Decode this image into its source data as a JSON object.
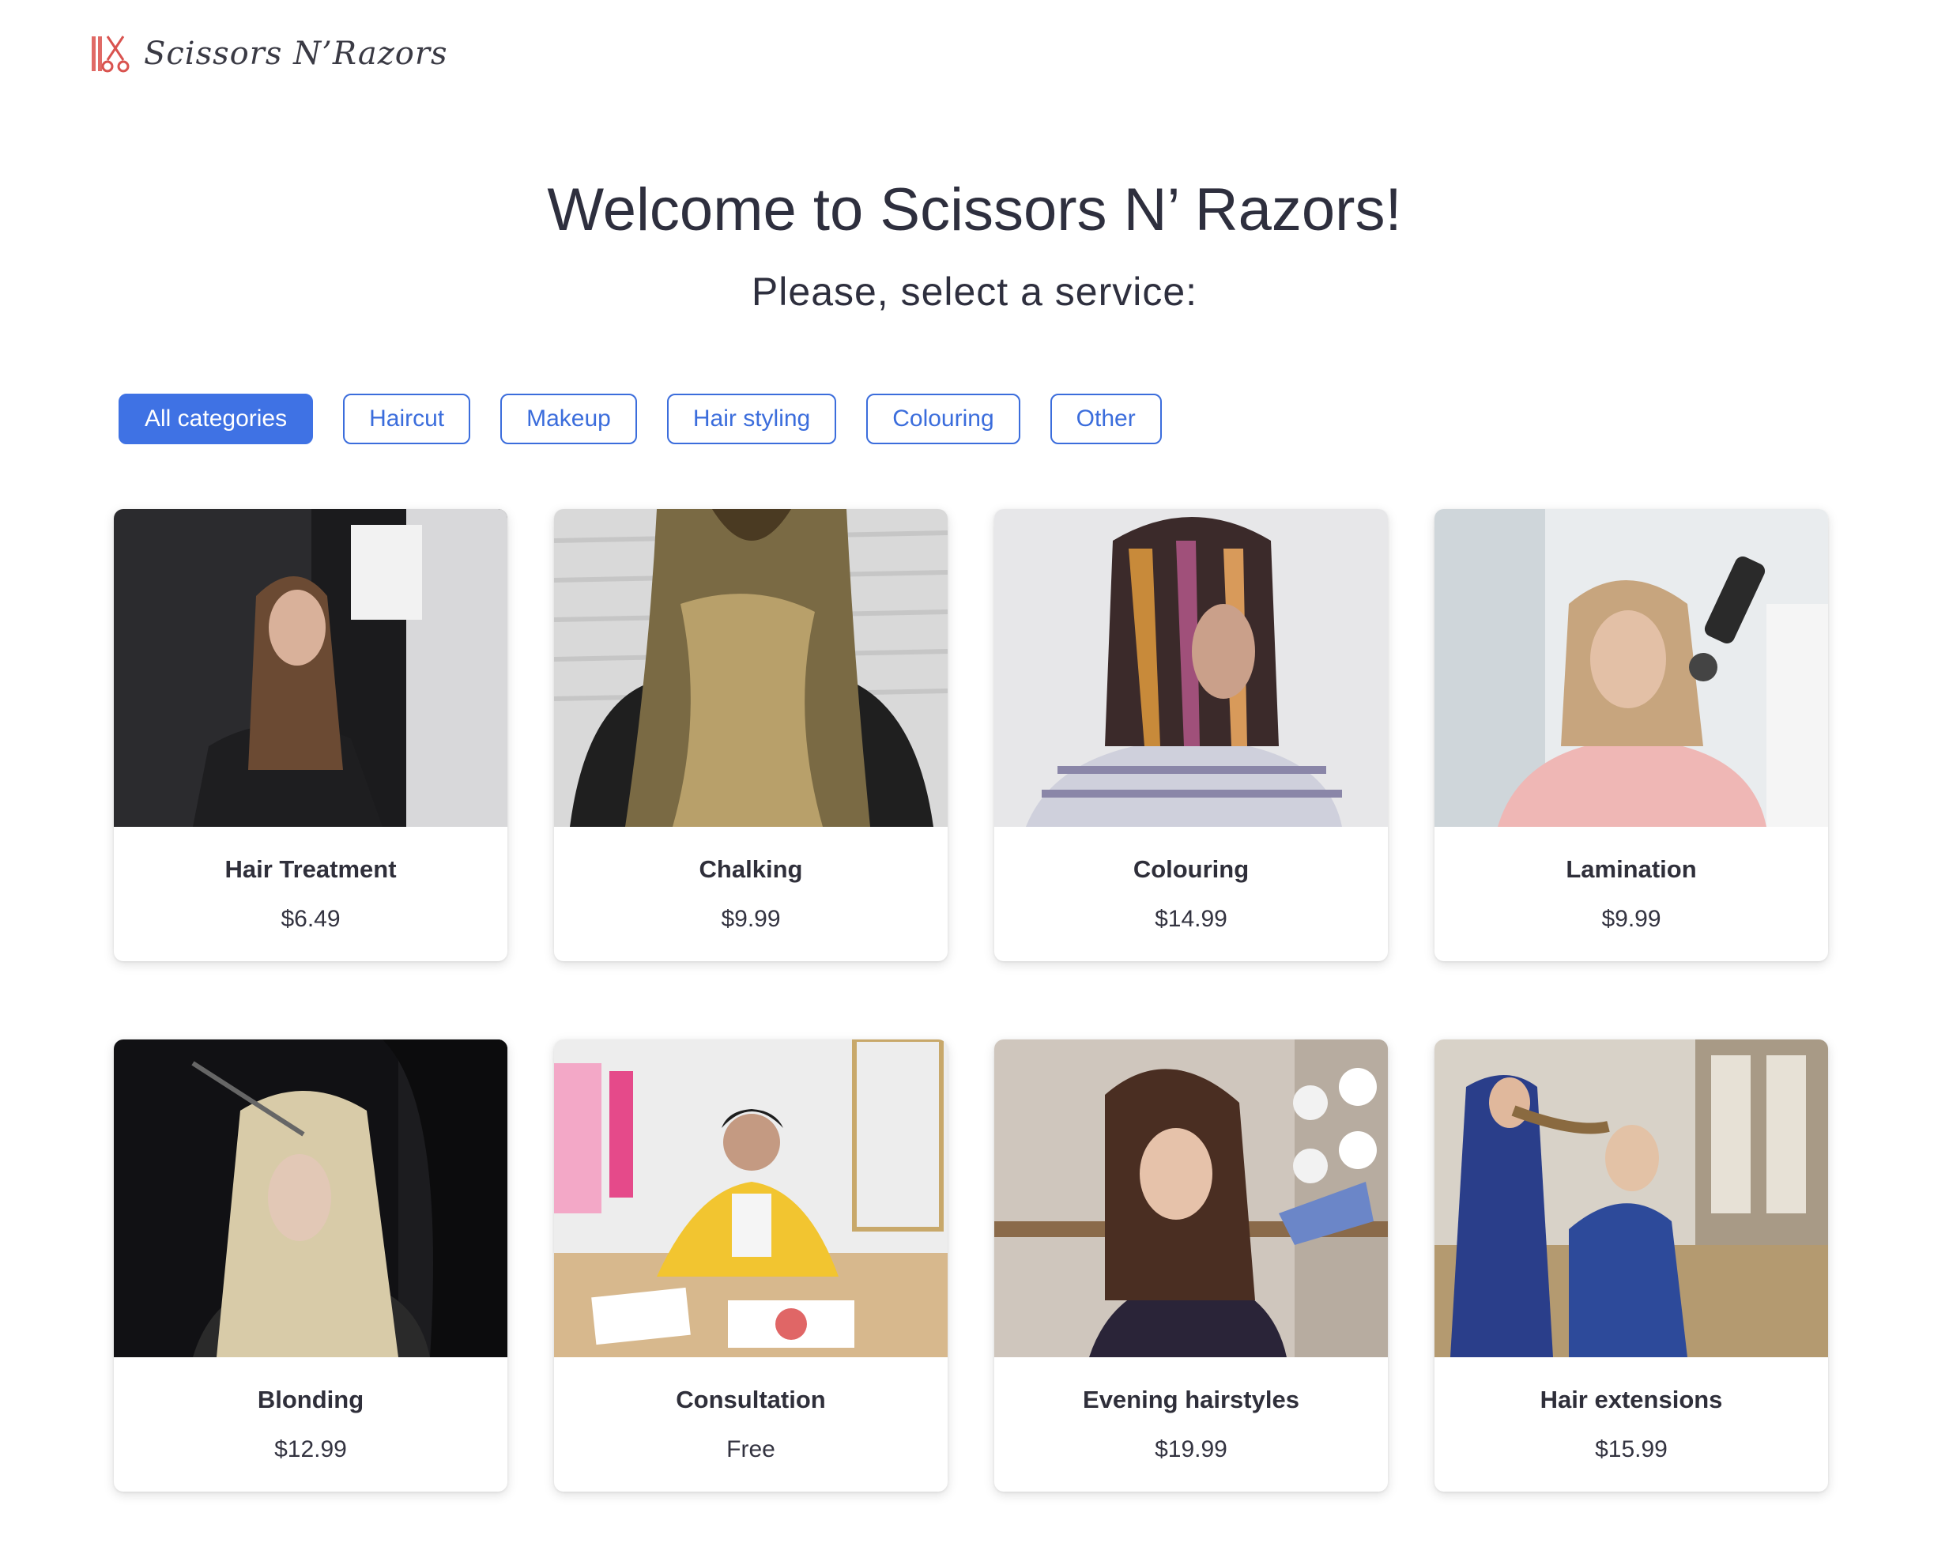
{
  "header": {
    "logo_text": "Scissors N’Razors"
  },
  "hero": {
    "title": "Welcome to Scissors N’ Razors!",
    "subtitle": "Please, select a service:"
  },
  "filters": [
    {
      "label": "All categories",
      "active": true
    },
    {
      "label": "Haircut",
      "active": false
    },
    {
      "label": "Makeup",
      "active": false
    },
    {
      "label": "Hair styling",
      "active": false
    },
    {
      "label": "Colouring",
      "active": false
    },
    {
      "label": "Other",
      "active": false
    }
  ],
  "services": [
    {
      "name": "Hair Treatment",
      "price": "$6.49"
    },
    {
      "name": "Chalking",
      "price": "$9.99"
    },
    {
      "name": "Colouring",
      "price": "$14.99"
    },
    {
      "name": "Lamination",
      "price": "$9.99"
    },
    {
      "name": "Blonding",
      "price": "$12.99"
    },
    {
      "name": "Consultation",
      "price": "Free"
    },
    {
      "name": "Evening hairstyles",
      "price": "$19.99"
    },
    {
      "name": "Hair extensions",
      "price": "$15.99"
    }
  ],
  "colors": {
    "accent": "#3f72e4",
    "accent_border": "#3b6ddc",
    "text": "#2e2f3e",
    "logo_red": "#d9534f"
  }
}
